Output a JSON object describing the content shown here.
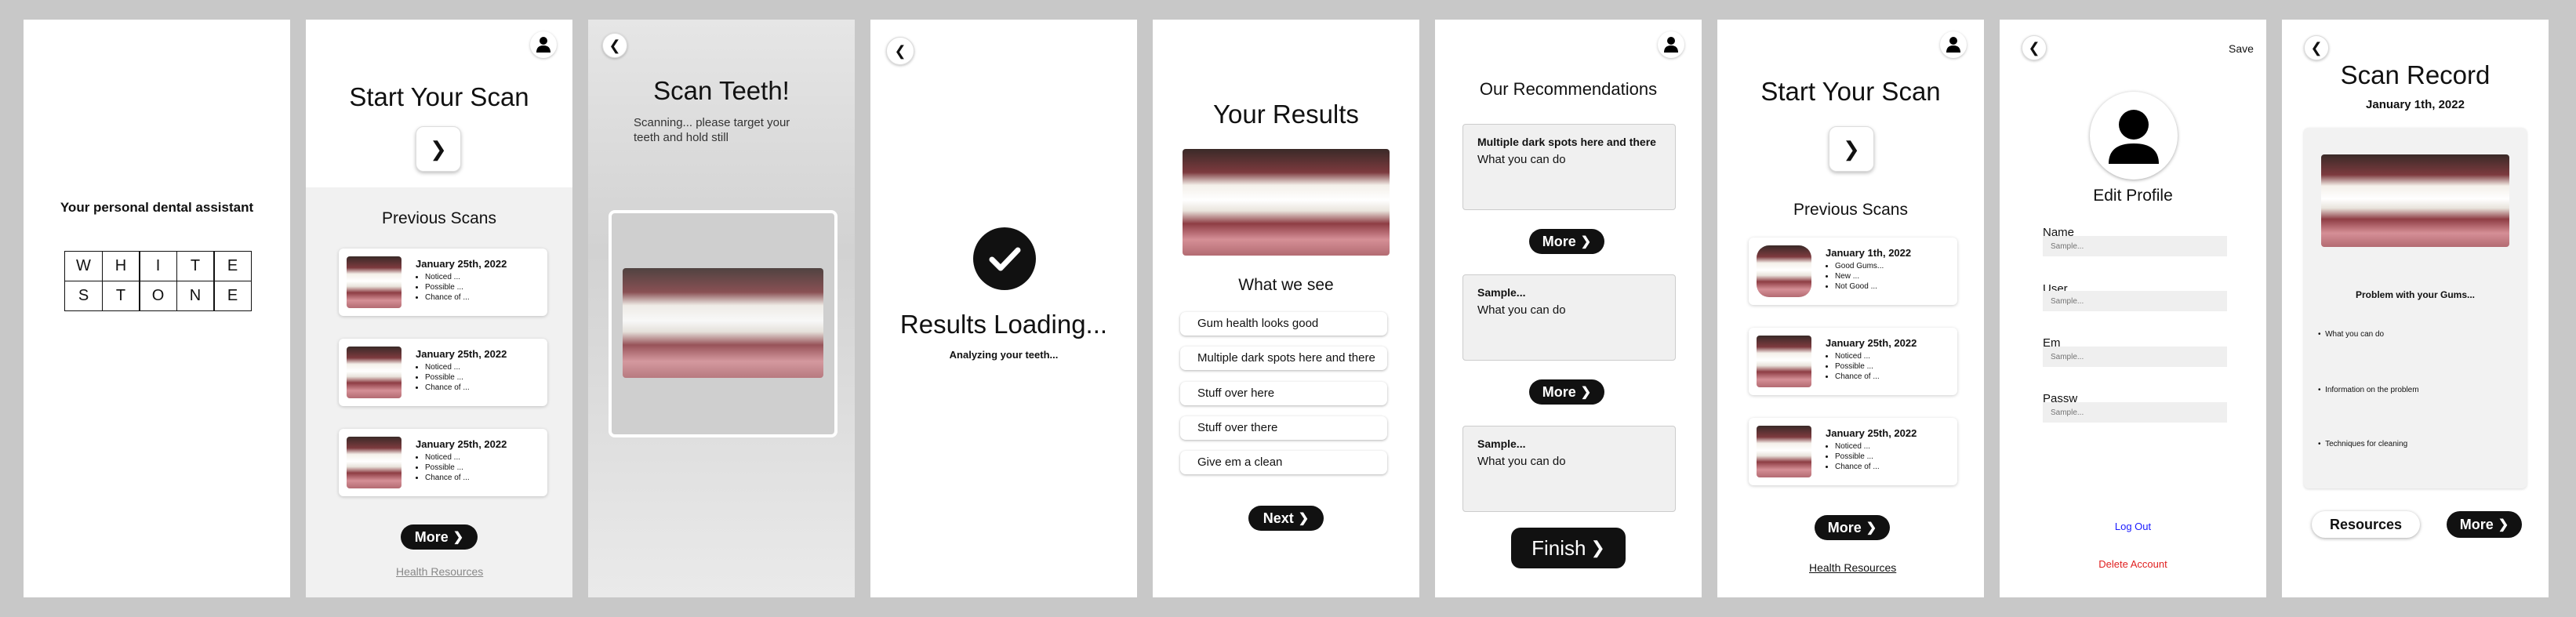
{
  "screen1": {
    "tagline": "Your personal dental assistant",
    "logo_row1": [
      "W",
      "H",
      "I",
      "T",
      "E"
    ],
    "logo_row2": [
      "S",
      "T",
      "O",
      "N",
      "E"
    ]
  },
  "screen2": {
    "title": "Start Your Scan",
    "previous_label": "Previous Scans",
    "scans": [
      {
        "date": "January 25th, 2022",
        "notes": [
          "Noticed ...",
          "Possible ...",
          "Chance of ..."
        ]
      },
      {
        "date": "January 25th, 2022",
        "notes": [
          "Noticed ...",
          "Possible ...",
          "Chance of ..."
        ]
      },
      {
        "date": "January 25th, 2022",
        "notes": [
          "Noticed ...",
          "Possible ...",
          "Chance of ..."
        ]
      }
    ],
    "more_label": "More",
    "resources_link": "Health Resources"
  },
  "screen3": {
    "title": "Scan Teeth!",
    "instruction": "Scanning... please target your teeth and hold still"
  },
  "screen4": {
    "title": "Results Loading...",
    "subtitle": "Analyzing your teeth..."
  },
  "screen5": {
    "title": "Your Results",
    "section": "What we see",
    "findings": [
      "Gum health looks good",
      "Multiple dark spots here and there",
      "Stuff over here",
      "Stuff over there",
      "Give em a clean"
    ],
    "next_label": "Next"
  },
  "screen6": {
    "title": "Our Recommendations",
    "recs": [
      {
        "title": "Multiple dark spots here and there",
        "body": "What you can do"
      },
      {
        "title": "Sample...",
        "body": "What you can do"
      },
      {
        "title": "Sample...",
        "body": "What you can do"
      }
    ],
    "more_label": "More",
    "finish_label": "Finish"
  },
  "screen7": {
    "title": "Start Your Scan",
    "previous_label": "Previous Scans",
    "scans": [
      {
        "date": "January 1th, 2022",
        "notes": [
          "Good Gums...",
          "New ...",
          "Not Good ..."
        ]
      },
      {
        "date": "January 25th, 2022",
        "notes": [
          "Noticed ...",
          "Possible ...",
          "Chance of ..."
        ]
      },
      {
        "date": "January 25th, 2022",
        "notes": [
          "Noticed ...",
          "Possible ...",
          "Chance of ..."
        ]
      }
    ],
    "more_label": "More",
    "resources_link": "Health Resources"
  },
  "screen8": {
    "save_label": "Save",
    "title": "Edit Profile",
    "fields": [
      {
        "label": "Name",
        "placeholder": "Sample..."
      },
      {
        "label": "User Name",
        "placeholder": "Sample..."
      },
      {
        "label": "Em ail",
        "placeholder": "Sample..."
      },
      {
        "label": "Passw ord",
        "placeholder": "Sample..."
      }
    ],
    "logout_label": "Log Out",
    "delete_label": "Delete Account",
    "colors": {
      "logout": "#1a1aff",
      "delete": "#e02020"
    }
  },
  "screen9": {
    "title": "Scan Record",
    "date": "January 1th, 2022",
    "problem": "Problem with your Gums...",
    "bullets": [
      "What you can do",
      "Information on the problem",
      "Techniques for cleaning"
    ],
    "resources_label": "Resources",
    "more_label": "More"
  },
  "icons": {
    "back": "chevron-left-icon",
    "forward": "chevron-right-icon",
    "profile": "user-icon",
    "check": "check-icon"
  }
}
